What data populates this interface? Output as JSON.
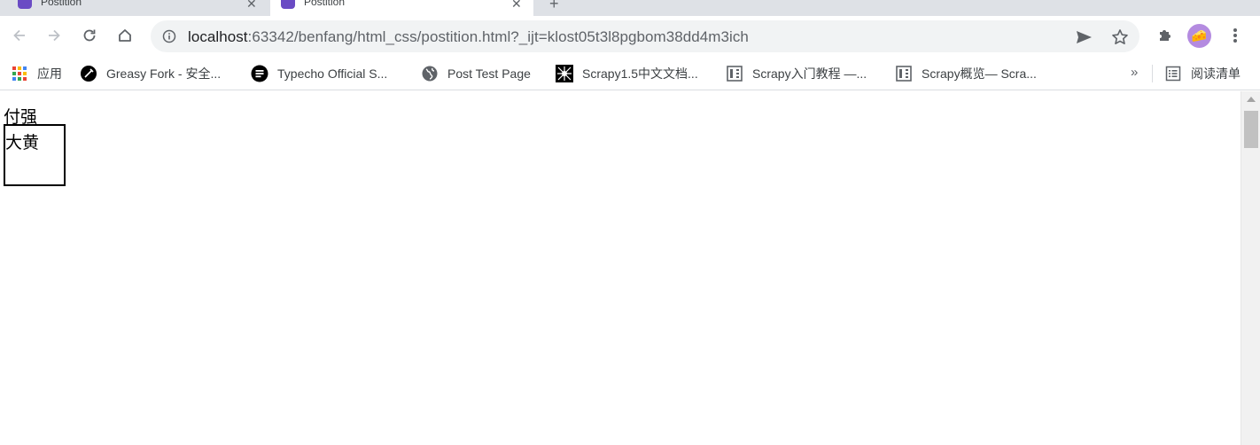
{
  "tabs": [
    {
      "title": "Postition",
      "close": "✕"
    },
    {
      "title": "Postition",
      "close": "✕"
    }
  ],
  "new_tab": "+",
  "toolbar": {
    "url_host": "localhost",
    "url_rest": ":63342/benfang/html_css/postition.html?_ijt=klost05t3l8pgbom38dd4m3ich"
  },
  "bookmarks": [
    {
      "label": "应用",
      "icon": "apps-grid-icon"
    },
    {
      "label": "Greasy Fork - 安全...",
      "icon": "greasyfork-icon"
    },
    {
      "label": "Typecho Official S...",
      "icon": "typecho-icon"
    },
    {
      "label": "Post Test Page",
      "icon": "globe-icon"
    },
    {
      "label": "Scrapy1.5中文文档...",
      "icon": "scrapy-spider-icon"
    },
    {
      "label": "Scrapy入门教程 —...",
      "icon": "book-icon"
    },
    {
      "label": "Scrapy概览— Scra...",
      "icon": "book-icon"
    }
  ],
  "bookmarks_more": "»",
  "reading_list": "阅读清单",
  "page": {
    "text1": "付强",
    "text2": "大黄"
  },
  "colors": {
    "tabstrip": "#dee1e6",
    "omnibox": "#f1f3f4",
    "avatar": "#b48be0",
    "favicon": "#6a4bc4"
  }
}
